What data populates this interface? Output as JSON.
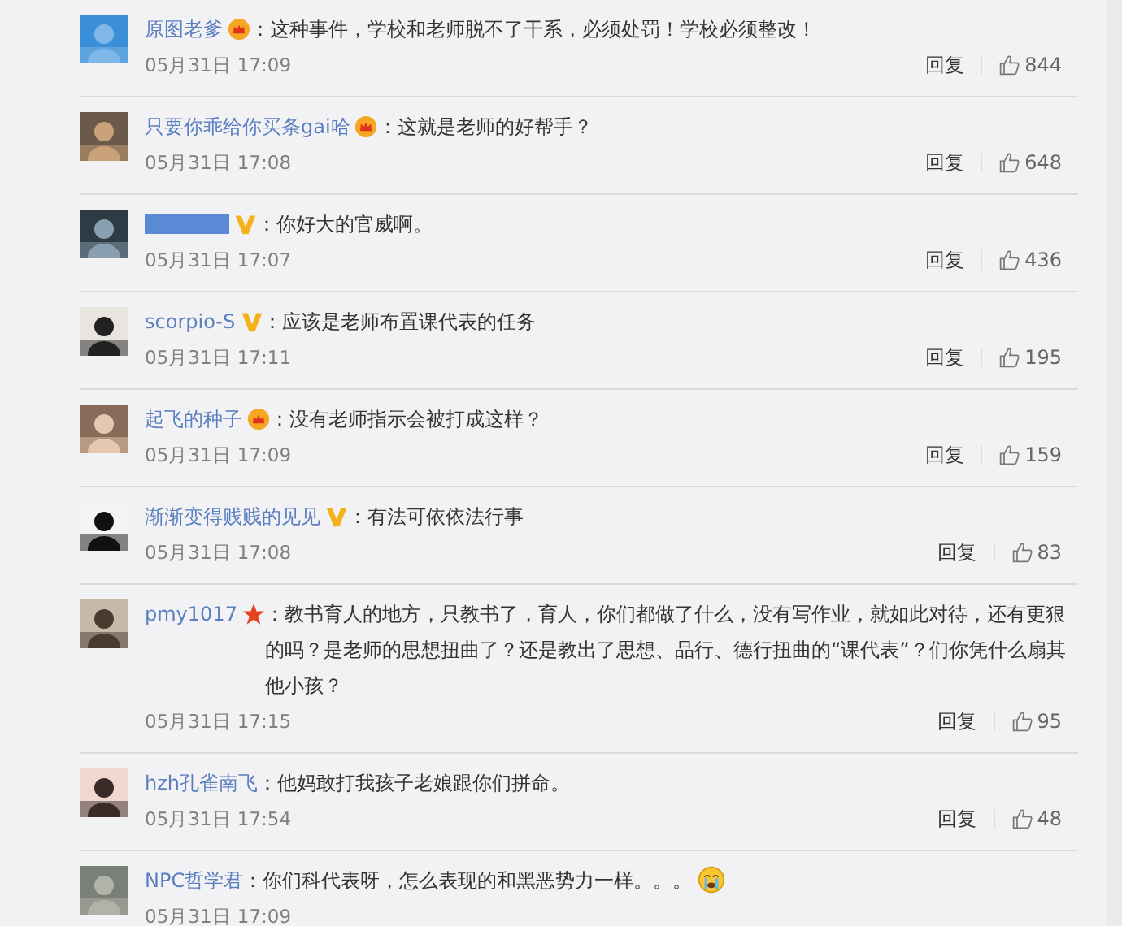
{
  "comments": [
    {
      "name": "原图老爹",
      "name_redacted": false,
      "kind": "crown",
      "text": "：这种事件，学校和老师脱不了干系，必须处罚！学校必须整改！",
      "time": "05月31日 17:09",
      "reply": "回复",
      "likes": "844"
    },
    {
      "name": "只要你乖给你买条gai哈",
      "name_redacted": false,
      "kind": "crown",
      "text": "：这就是老师的好帮手？",
      "time": "05月31日 17:08",
      "reply": "回复",
      "likes": "648"
    },
    {
      "name_redacted": true,
      "kind": "v",
      "text": "：你好大的官威啊。",
      "time": "05月31日 17:07",
      "reply": "回复",
      "likes": "436"
    },
    {
      "name": "scorpio-S",
      "name_redacted": false,
      "kind": "v",
      "text": "：应该是老师布置课代表的任务",
      "time": "05月31日 17:11",
      "reply": "回复",
      "likes": "195"
    },
    {
      "name": "起飞的种子",
      "name_redacted": false,
      "kind": "crown",
      "text": "：没有老师指示会被打成这样？",
      "time": "05月31日 17:09",
      "reply": "回复",
      "likes": "159"
    },
    {
      "name": "渐渐变得贱贱的见见",
      "name_redacted": false,
      "kind": "v",
      "text": "：有法可依依法行事",
      "time": "05月31日 17:08",
      "reply": "回复",
      "likes": "83"
    },
    {
      "name": "pmy1017",
      "name_redacted": false,
      "kind": "star",
      "text": "：教书育人的地方，只教书了，育人，你们都做了什么，没有写作业，就如此对待，还有更狠的吗？是老师的思想扭曲了？还是教出了思想、品行、德行扭曲的“课代表”？们你凭什么扇其他小孩？",
      "time": "05月31日 17:15",
      "reply": "回复",
      "likes": "95"
    },
    {
      "name": "hzh孔雀南飞",
      "name_redacted": false,
      "kind": "plain",
      "text": "：他妈敢打我孩子老娘跟你们拼命。",
      "time": "05月31日 17:54",
      "reply": "回复",
      "likes": "48"
    },
    {
      "name": "NPC哲学君",
      "name_redacted": false,
      "kind": "plain",
      "text": "：你们科代表呀，怎么表现的和黑恶势力一样。。。",
      "crying_emoji": true,
      "time": "05月31日 17:09"
    }
  ]
}
